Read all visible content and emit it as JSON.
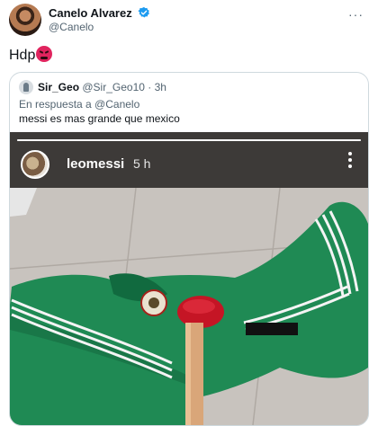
{
  "tweet": {
    "author_name": "Canelo Alvarez",
    "author_handle": "@Canelo",
    "text": "Hdp",
    "more": "···"
  },
  "quoted": {
    "author_name": "Sir_Geo",
    "author_handle": "@Sir_Geo10",
    "time": "· 3h",
    "reply_to": "En respuesta a @Canelo",
    "text": "messi es mas grande que mexico",
    "story": {
      "username": "leomessi",
      "time": "5 h",
      "progress": 1.0
    }
  },
  "colors": {
    "verified": "#1d9bf0",
    "jersey": "#1f8a54",
    "plunger_cup": "#d11a2a",
    "secondary_text": "#536471"
  }
}
